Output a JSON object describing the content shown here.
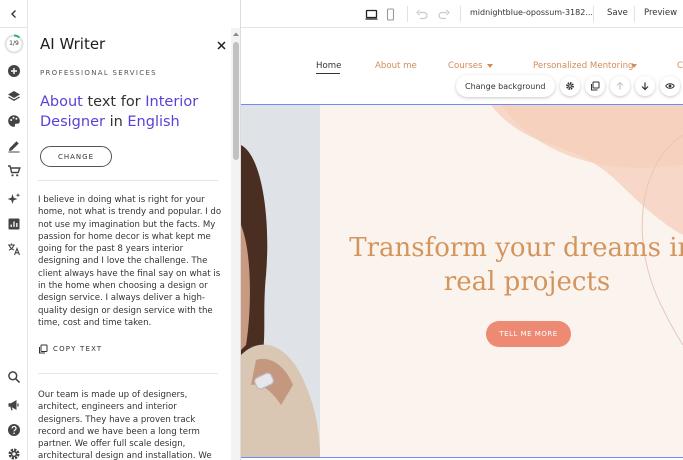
{
  "rail": {
    "progress": "1/9",
    "progress_fraction": 0.11,
    "icons": [
      "back-arrow-icon",
      "add-icon",
      "layers-icon",
      "palette-icon",
      "pen-icon",
      "cart-icon",
      "sparkle-icon",
      "analytics-icon",
      "translate-icon",
      "search-icon",
      "megaphone-icon",
      "help-icon",
      "gear-icon"
    ]
  },
  "panel": {
    "title": "AI Writer",
    "kicker": "PROFESSIONAL SERVICES",
    "heading": {
      "topic": "About",
      "text_for": "text for",
      "business": "Interior Designer",
      "in": "in",
      "language": "English"
    },
    "change_label": "CHANGE",
    "paragraph1": "I believe in doing what is right for your home, not what is trendy and popular. I do not use my imagination but the facts. My passion for home decor is what kept me going for the past 8 years interior designing and I love the challenge. The client always have the final say on what is in the home when choosing a design or design service. I always deliver a high-quality design or design service with the time, cost and time taken.",
    "copy_label": "COPY TEXT",
    "paragraph2": "Our team is made up of designers, architect, engineers and interior designers. They have a proven track record and we have been a long term partner. We offer full scale design, architectural design and installation. We also work with companies"
  },
  "toolbar": {
    "site_name": "midnightblue-opossum-3182...",
    "save_label": "Save",
    "preview_label": "Preview"
  },
  "site": {
    "nav": {
      "home": "Home",
      "about": "About me",
      "courses": "Courses",
      "mentoring": "Personalized Mentoring",
      "more": "C"
    },
    "change_background": "Change background",
    "hero_line1": "Transform your dreams int",
    "hero_line2": "real projects",
    "hero_button": "TELL ME MORE"
  },
  "colors": {
    "accent_purple": "#5b3fd8",
    "nav_orange": "#d28b57",
    "hero_title": "#d4955d",
    "hero_bg": "#fbf4ee",
    "hero_button": "#ee8a73",
    "selection_blue": "#6b8ff0"
  }
}
